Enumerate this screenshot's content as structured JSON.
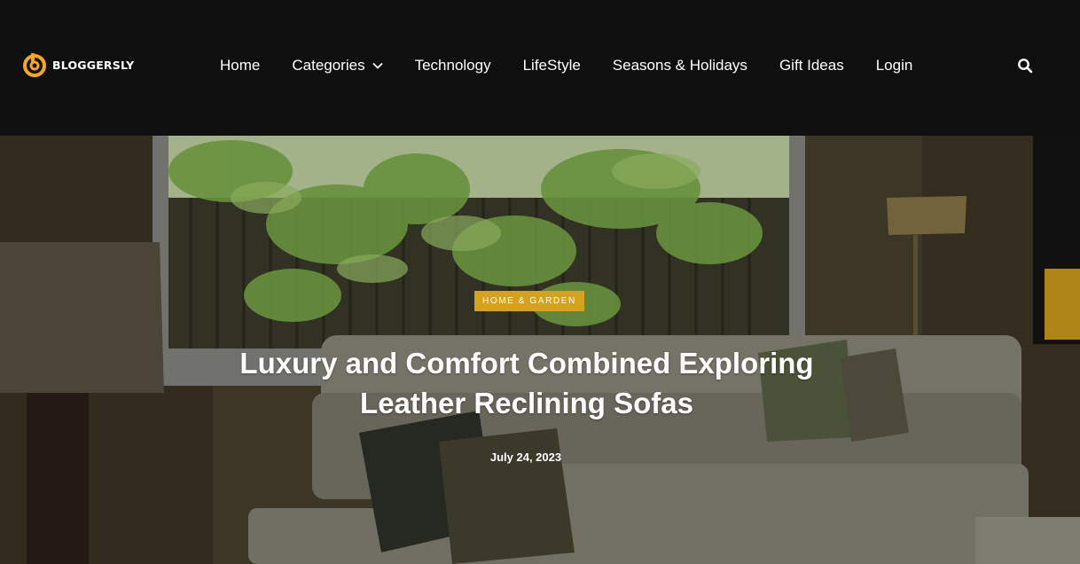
{
  "site": {
    "logo_text": "BLOGGERSLY",
    "brand_color": "#f6a81c"
  },
  "nav": {
    "items": [
      {
        "label": "Home"
      },
      {
        "label": "Categories",
        "has_dropdown": true
      },
      {
        "label": "Technology"
      },
      {
        "label": "LifeStyle"
      },
      {
        "label": "Seasons & Holidays"
      },
      {
        "label": "Gift Ideas"
      },
      {
        "label": "Login"
      }
    ],
    "search_icon": "search-icon"
  },
  "hero": {
    "category": "HOME & GARDEN",
    "category_color": "#d6a21c",
    "title": "Luxury and Comfort Combined Exploring Leather Reclining Sofas",
    "date": "July 24, 2023"
  }
}
